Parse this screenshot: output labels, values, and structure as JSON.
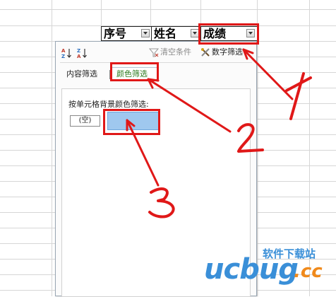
{
  "sheet": {
    "headers": [
      {
        "label": "序号"
      },
      {
        "label": "姓名"
      },
      {
        "label": "成绩"
      }
    ]
  },
  "filter_panel": {
    "toolbar": {
      "sort_asc_icon": "sort-ascending-icon",
      "sort_desc_icon": "sort-descending-icon",
      "clear_label": "清空条件",
      "number_filter_label": "数字筛选"
    },
    "tabs": [
      {
        "label": "内容筛选"
      },
      {
        "label": "颜色筛选",
        "active": true
      }
    ],
    "color_section": {
      "label": "按单元格背景颜色筛选:",
      "empty_option": "(空)",
      "swatch_color": "#9fc8ef"
    }
  },
  "annotations": {
    "highlight_color": "#e01818"
  },
  "watermark": {
    "text": "软件下载站",
    "logo_left": "ucbug",
    "logo_right": ".cc"
  }
}
